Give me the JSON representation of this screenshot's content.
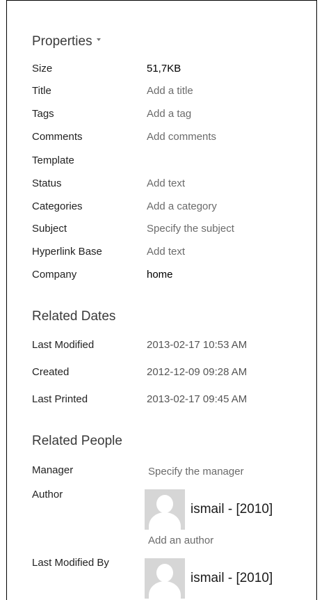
{
  "properties": {
    "title": "Properties",
    "rows": [
      {
        "label": "Size",
        "value": "51,7KB",
        "editable": false
      },
      {
        "label": "Title",
        "value": "Add a title",
        "editable": true
      },
      {
        "label": "Tags",
        "value": "Add a tag",
        "editable": true
      },
      {
        "label": "Comments",
        "value": "Add comments",
        "editable": true
      },
      {
        "label": "Template",
        "value": "",
        "editable": false
      },
      {
        "label": "Status",
        "value": "Add text",
        "editable": true
      },
      {
        "label": "Categories",
        "value": "Add a category",
        "editable": true
      },
      {
        "label": "Subject",
        "value": "Specify the subject",
        "editable": true
      },
      {
        "label": "Hyperlink Base",
        "value": "Add text",
        "editable": true
      },
      {
        "label": "Company",
        "value": "home",
        "editable": false
      }
    ]
  },
  "related_dates": {
    "title": "Related Dates",
    "rows": [
      {
        "label": "Last Modified",
        "value": "2013-02-17 10:53 AM"
      },
      {
        "label": "Created",
        "value": "2012-12-09 09:28 AM"
      },
      {
        "label": "Last Printed",
        "value": "2013-02-17 09:45 AM"
      }
    ]
  },
  "related_people": {
    "title": "Related People",
    "manager_label": "Manager",
    "manager_value": "Specify the manager",
    "author_label": "Author",
    "author_name": "ismail - [2010]",
    "add_author": "Add an author",
    "last_modified_by_label": "Last Modified By",
    "last_modified_by_name": "ismail - [2010]"
  }
}
